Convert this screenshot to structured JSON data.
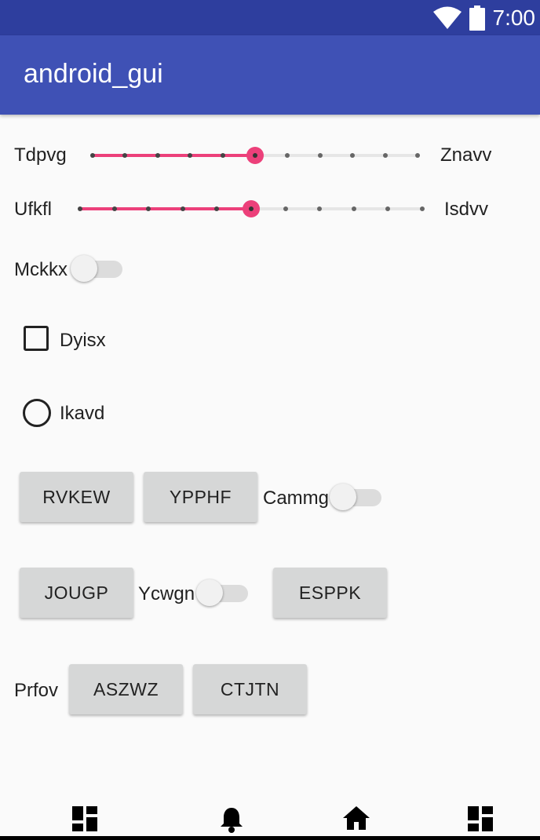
{
  "status_bar": {
    "time": "7:00",
    "icons": [
      "wifi-icon",
      "battery-icon"
    ]
  },
  "app_bar": {
    "title": "android_gui"
  },
  "sliders": [
    {
      "left_label": "Tdpvg",
      "right_label": "Znavv",
      "steps": 10,
      "value": 5
    },
    {
      "left_label": "Ufkfl",
      "right_label": "Isdvv",
      "steps": 10,
      "value": 5
    }
  ],
  "switch_1": {
    "label": "Mckkx",
    "checked": false
  },
  "checkbox": {
    "label": "Dyisx",
    "checked": false
  },
  "radio": {
    "label": "Ikavd",
    "checked": false
  },
  "row1": {
    "button_1": "RVKEW",
    "button_2": "YPPHF",
    "switch_label": "Cammg"
  },
  "row2": {
    "button_1": "JOUGP",
    "switch_label": "Ycwgn",
    "button_2": "ESPPK"
  },
  "row3": {
    "label": "Prfov",
    "button_1": "ASZWZ",
    "button_2": "CTJTN"
  },
  "bottom_nav": {
    "items": [
      "dashboard-icon",
      "bell-icon",
      "home-icon",
      "dashboard-icon"
    ]
  },
  "colors": {
    "status_bar": "#2e3e9e",
    "app_bar": "#3f51b5",
    "accent": "#ec407a",
    "button": "#d6d7d7"
  }
}
